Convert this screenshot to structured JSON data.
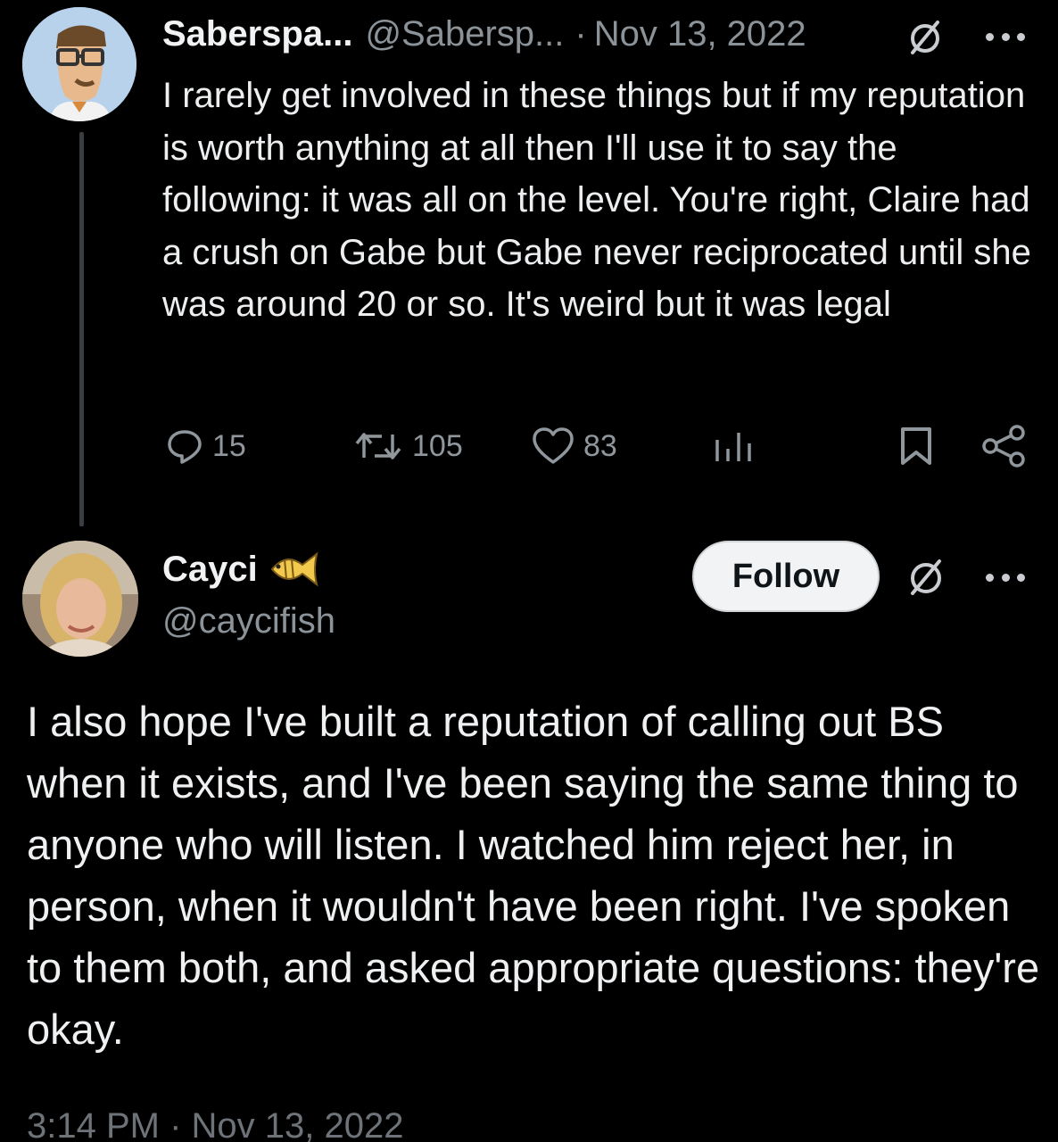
{
  "tweet1": {
    "display_name": "Saberspa...",
    "handle": "@Sabersp...",
    "separator": "·",
    "date": "Nov 13, 2022",
    "body": "I rarely get involved in these things but if my reputation is worth anything at all then I'll use it to say the following: it was all on the level. You're right, Claire had a crush on Gabe but Gabe never reciprocated until she was around 20 or so. It's weird but it was legal",
    "actions": {
      "replies": "15",
      "retweets": "105",
      "likes": "83"
    }
  },
  "tweet2": {
    "display_name": "Cayci",
    "handle": "@caycifish",
    "follow_label": "Follow",
    "body": "I also hope I've built a reputation of calling out BS when it exists, and I've been saying the same thing to anyone who will listen. I watched him reject her, in person, when it wouldn't have been right. I've spoken to them both, and asked appropriate questions: they're okay.",
    "timestamp": "3:14 PM · Nov 13, 2022"
  },
  "icons": {
    "verify": "slashed-circle-icon",
    "more": "more-horizontal-icon",
    "reply": "reply-icon",
    "retweet": "retweet-icon",
    "like": "heart-icon",
    "views": "analytics-icon",
    "bookmark": "bookmark-icon",
    "share": "share-icon",
    "badge": "fish-emoji-icon"
  },
  "colors": {
    "background": "#000000",
    "text": "#e7e9ea",
    "muted": "#8b9298",
    "follow_bg": "#f1f3f4"
  }
}
